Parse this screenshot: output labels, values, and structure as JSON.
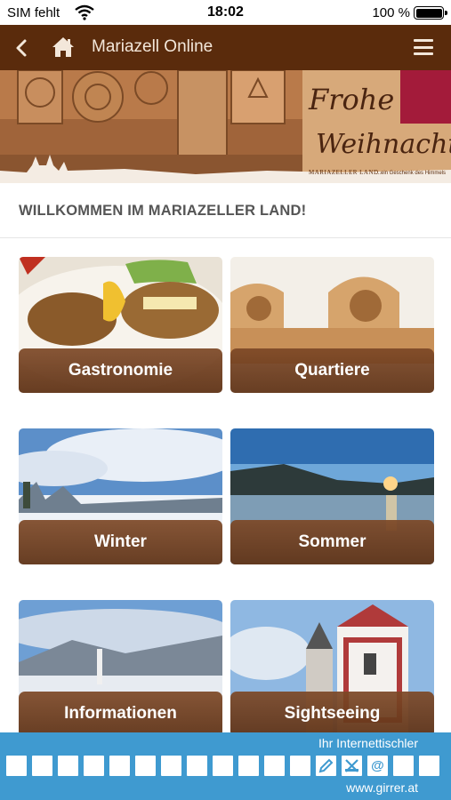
{
  "status_bar": {
    "carrier": "SIM fehlt",
    "time": "18:02",
    "battery": "100 %"
  },
  "nav": {
    "title": "Mariazell Online",
    "icons": [
      "chevron-left-icon",
      "home-icon",
      "hamburger-menu-icon"
    ]
  },
  "banner": {
    "greeting_line1": "Frohe",
    "greeting_line2": "Weihnachten",
    "logo": "MARIAZELLER LAND",
    "slogan": "...ein Geschenk des Himmels"
  },
  "welcome": "WILLKOMMEN IM MARIAZELLER LAND!",
  "tiles": [
    {
      "label": "Gastronomie"
    },
    {
      "label": "Quartiere"
    },
    {
      "label": "Winter"
    },
    {
      "label": "Sommer"
    },
    {
      "label": "Informationen"
    },
    {
      "label": "Sightseeing"
    }
  ],
  "footer": {
    "tagline": "Ihr Internettischler",
    "url": "www.girrer.at",
    "square_count": 17,
    "icon_squares": [
      "pen-icon",
      "tools-icon",
      "at-icon"
    ]
  },
  "colors": {
    "nav_bg": "#5a2b0c",
    "footer_bg": "#3f9ad0",
    "caption_bg": "#7d4826"
  }
}
